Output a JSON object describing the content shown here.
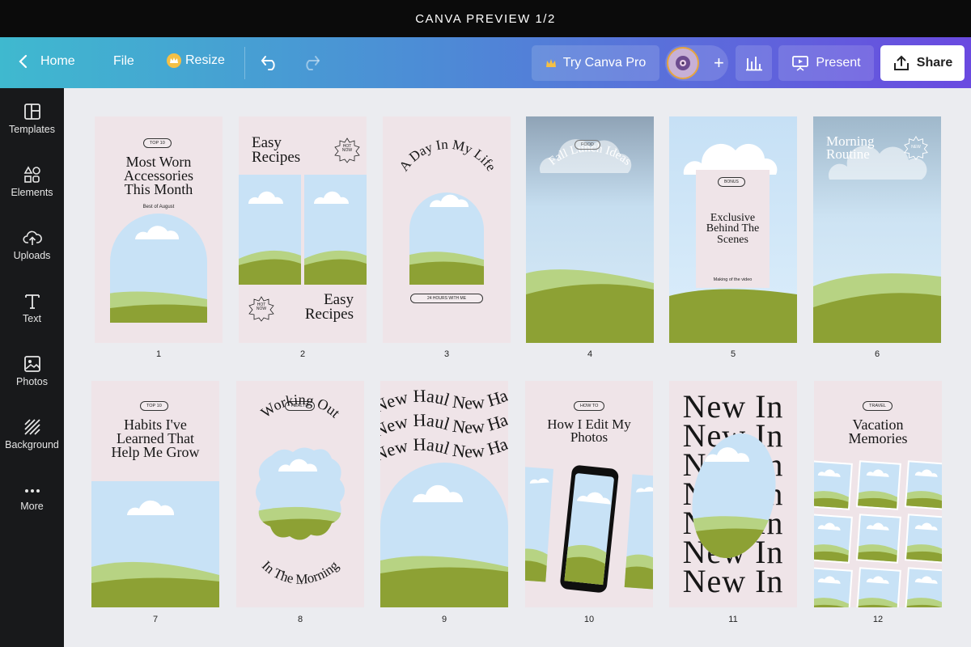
{
  "window_title": "CANVA PREVIEW 1/2",
  "toolbar": {
    "home": "Home",
    "file": "File",
    "resize": "Resize",
    "try_pro": "Try Canva Pro",
    "plus": "+",
    "present": "Present",
    "share": "Share"
  },
  "sidebar": {
    "items": [
      {
        "label": "Templates",
        "icon": "templates-icon"
      },
      {
        "label": "Elements",
        "icon": "elements-icon"
      },
      {
        "label": "Uploads",
        "icon": "uploads-icon"
      },
      {
        "label": "Text",
        "icon": "text-icon"
      },
      {
        "label": "Photos",
        "icon": "photos-icon"
      },
      {
        "label": "Background",
        "icon": "background-icon"
      },
      {
        "label": "More",
        "icon": "more-icon"
      }
    ]
  },
  "colors": {
    "sky_top": "#b9dcf6",
    "hill_light": "#b7d383",
    "hill_dark": "#8da134",
    "card_bg": "#efe4e8"
  },
  "pages": [
    {
      "number": "1",
      "tag": "TOP 10",
      "title": [
        "Most Worn",
        "Accessories",
        "This Month"
      ],
      "sub": "Best of August"
    },
    {
      "number": "2",
      "title_top": [
        "Easy",
        "Recipes"
      ],
      "badge_top": [
        "HOT",
        "NOW"
      ],
      "badge_bottom": [
        "HOT",
        "NOW"
      ],
      "title_bottom": [
        "Easy",
        "Recipes"
      ]
    },
    {
      "number": "3",
      "title": "A Day In My Life",
      "tag": "24 HOURS WITH ME"
    },
    {
      "number": "4",
      "tag": "FOOD",
      "title": "Fall Lunch Ideas"
    },
    {
      "number": "5",
      "tag": "BONUS",
      "title": [
        "Exclusive",
        "Behind The",
        "Scenes"
      ],
      "sub": "Making of the video"
    },
    {
      "number": "6",
      "title": [
        "Morning",
        "Routine"
      ],
      "badge": "NEW"
    },
    {
      "number": "7",
      "tag": "TOP 10",
      "title": [
        "Habits I've",
        "Learned That",
        "Help Me Grow"
      ]
    },
    {
      "number": "8",
      "tag": "HEALTH",
      "title_top": "Working Out",
      "title_bottom": "In The Morning",
      "arrow": "→"
    },
    {
      "number": "9",
      "repeat_text": "New Haul New Haul Ne"
    },
    {
      "number": "10",
      "tag": "HOW TO",
      "title": [
        "How I Edit My",
        "Photos"
      ]
    },
    {
      "number": "11",
      "repeat_text": "New In"
    },
    {
      "number": "12",
      "tag": "TRAVEL",
      "title": [
        "Vacation",
        "Memories"
      ]
    }
  ]
}
